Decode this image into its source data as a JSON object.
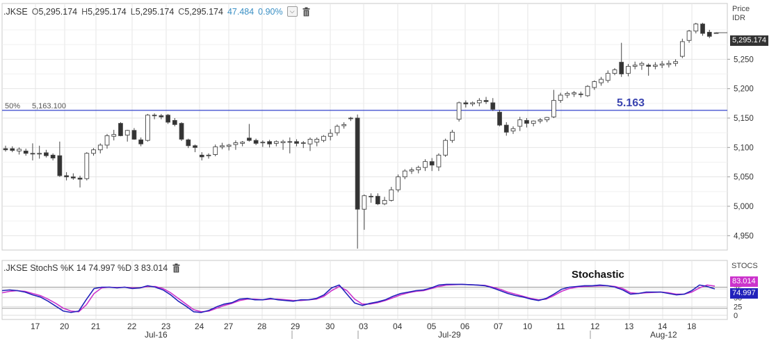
{
  "price_header": {
    "symbol": ".JKSE",
    "open_label": "O",
    "open": "5,295.174",
    "high_label": "H",
    "high": "5,295.174",
    "low_label": "L",
    "low": "5,295.174",
    "close_label": "C",
    "close": "5,295.174",
    "change": "47.484",
    "change_pct": "0.90%"
  },
  "price_axis": {
    "title": "Price",
    "unit": "IDR",
    "last_value": "5,295.174"
  },
  "stoch_header": {
    "text": ".JKSE StochS %K 14 74.997 %D 3 83.014"
  },
  "stoch_axis": {
    "title": "STOCS",
    "d_value": "83.014",
    "k_value": "74.997"
  },
  "colors": {
    "k_line": "#2222bb",
    "d_line": "#cc33cc",
    "hline": "#3344cc",
    "d_tag": "#cc33cc",
    "k_tag": "#2222bb",
    "last_tag": "#333333"
  },
  "chart_data": [
    {
      "type": "candlestick",
      "title": "",
      "ylabel": "Price IDR",
      "ylim": [
        4925,
        5315
      ],
      "y_ticks": [
        "4,950",
        "5,000",
        "5,050",
        "5,100",
        "5,150",
        "5,200",
        "5,250"
      ],
      "x_tick_labels": [
        "17",
        "20",
        "21",
        "22",
        "23",
        "24",
        "27",
        "28",
        "29",
        "30",
        "03",
        "04",
        "05",
        "06",
        "07",
        "10",
        "11",
        "12",
        "13",
        "14",
        "18"
      ],
      "x_month_labels": [
        "Jul-16",
        "Jul-29",
        "Aug-12"
      ],
      "fib_line": {
        "label": "50%",
        "value_label": "5,163.100",
        "value": 5163.1,
        "annotation": "5.163"
      },
      "candles": [
        {
          "d": "12",
          "o": 5098,
          "h": 5103,
          "l": 5093,
          "c": 5096
        },
        {
          "d": "13",
          "o": 5098,
          "h": 5102,
          "l": 5092,
          "c": 5095
        },
        {
          "d": "13",
          "o": 5094,
          "h": 5100,
          "l": 5088,
          "c": 5097
        },
        {
          "d": "14",
          "o": 5094,
          "h": 5098,
          "l": 5086,
          "c": 5090
        },
        {
          "d": "15",
          "o": 5090,
          "h": 5107,
          "l": 5078,
          "c": 5089
        },
        {
          "d": "16",
          "o": 5089,
          "h": 5103,
          "l": 5081,
          "c": 5090
        },
        {
          "d": "16",
          "o": 5091,
          "h": 5096,
          "l": 5083,
          "c": 5086
        },
        {
          "d": "17",
          "o": 5087,
          "h": 5090,
          "l": 5078,
          "c": 5082
        },
        {
          "d": "17",
          "o": 5086,
          "h": 5110,
          "l": 5050,
          "c": 5052
        },
        {
          "d": "18",
          "o": 5052,
          "h": 5058,
          "l": 5044,
          "c": 5050
        },
        {
          "d": "19",
          "o": 5050,
          "h": 5056,
          "l": 5045,
          "c": 5048
        },
        {
          "d": "20",
          "o": 5048,
          "h": 5052,
          "l": 5032,
          "c": 5046
        },
        {
          "d": "21",
          "o": 5047,
          "h": 5092,
          "l": 5044,
          "c": 5090
        },
        {
          "d": "21",
          "o": 5090,
          "h": 5099,
          "l": 5086,
          "c": 5096
        },
        {
          "d": "21",
          "o": 5096,
          "h": 5107,
          "l": 5090,
          "c": 5104
        },
        {
          "d": "22",
          "o": 5104,
          "h": 5123,
          "l": 5098,
          "c": 5120
        },
        {
          "d": "22",
          "o": 5119,
          "h": 5130,
          "l": 5112,
          "c": 5122
        },
        {
          "d": "22",
          "o": 5141,
          "h": 5143,
          "l": 5119,
          "c": 5120
        },
        {
          "d": "23",
          "o": 5121,
          "h": 5130,
          "l": 5110,
          "c": 5129
        },
        {
          "d": "23",
          "o": 5129,
          "h": 5133,
          "l": 5113,
          "c": 5114
        },
        {
          "d": "23",
          "o": 5113,
          "h": 5117,
          "l": 5102,
          "c": 5106
        },
        {
          "d": "24",
          "o": 5112,
          "h": 5157,
          "l": 5110,
          "c": 5155
        },
        {
          "d": "24",
          "o": 5155,
          "h": 5158,
          "l": 5148,
          "c": 5154
        },
        {
          "d": "24",
          "o": 5154,
          "h": 5157,
          "l": 5148,
          "c": 5152
        },
        {
          "d": "25",
          "o": 5155,
          "h": 5157,
          "l": 5140,
          "c": 5143
        },
        {
          "d": "25",
          "o": 5146,
          "h": 5150,
          "l": 5136,
          "c": 5139
        },
        {
          "d": "26",
          "o": 5141,
          "h": 5143,
          "l": 5111,
          "c": 5114
        },
        {
          "d": "26",
          "o": 5113,
          "h": 5115,
          "l": 5099,
          "c": 5103
        },
        {
          "d": "26",
          "o": 5103,
          "h": 5105,
          "l": 5092,
          "c": 5100
        },
        {
          "d": "27",
          "o": 5087,
          "h": 5092,
          "l": 5078,
          "c": 5084
        },
        {
          "d": "27",
          "o": 5086,
          "h": 5090,
          "l": 5081,
          "c": 5087
        },
        {
          "d": "28",
          "o": 5088,
          "h": 5105,
          "l": 5085,
          "c": 5101
        },
        {
          "d": "28",
          "o": 5101,
          "h": 5108,
          "l": 5097,
          "c": 5103
        },
        {
          "d": "28",
          "o": 5102,
          "h": 5106,
          "l": 5095,
          "c": 5104
        },
        {
          "d": "29",
          "o": 5105,
          "h": 5112,
          "l": 5096,
          "c": 5108
        },
        {
          "d": "29",
          "o": 5107,
          "h": 5111,
          "l": 5102,
          "c": 5109
        },
        {
          "d": "29",
          "o": 5116,
          "h": 5140,
          "l": 5110,
          "c": 5112
        },
        {
          "d": "30",
          "o": 5112,
          "h": 5115,
          "l": 5104,
          "c": 5107
        },
        {
          "d": "30",
          "o": 5108,
          "h": 5112,
          "l": 5101,
          "c": 5109
        },
        {
          "d": "30",
          "o": 5110,
          "h": 5113,
          "l": 5100,
          "c": 5106
        },
        {
          "d": "31",
          "o": 5107,
          "h": 5112,
          "l": 5102,
          "c": 5110
        },
        {
          "d": "31",
          "o": 5108,
          "h": 5113,
          "l": 5096,
          "c": 5110
        },
        {
          "d": "31",
          "o": 5110,
          "h": 5117,
          "l": 5090,
          "c": 5109
        },
        {
          "d": "32",
          "o": 5110,
          "h": 5114,
          "l": 5102,
          "c": 5107
        },
        {
          "d": "32",
          "o": 5107,
          "h": 5111,
          "l": 5099,
          "c": 5108
        },
        {
          "d": "33",
          "o": 5106,
          "h": 5117,
          "l": 5094,
          "c": 5114
        },
        {
          "d": "33",
          "o": 5109,
          "h": 5117,
          "l": 5102,
          "c": 5114
        },
        {
          "d": "33",
          "o": 5112,
          "h": 5121,
          "l": 5109,
          "c": 5119
        },
        {
          "d": "34",
          "o": 5119,
          "h": 5131,
          "l": 5112,
          "c": 5124
        },
        {
          "d": "34",
          "o": 5125,
          "h": 5139,
          "l": 5120,
          "c": 5136
        },
        {
          "d": "35",
          "o": 5137,
          "h": 5143,
          "l": 5132,
          "c": 5139
        },
        {
          "d": "35",
          "o": 5150,
          "h": 5152,
          "l": 5145,
          "c": 5149
        },
        {
          "d": "35",
          "o": 5150,
          "h": 5156,
          "l": 4928,
          "c": 4995
        },
        {
          "d": "36",
          "o": 4995,
          "h": 5020,
          "l": 4960,
          "c": 5018
        },
        {
          "d": "36",
          "o": 5017,
          "h": 5022,
          "l": 5006,
          "c": 5016
        },
        {
          "d": "36",
          "o": 5017,
          "h": 5022,
          "l": 5002,
          "c": 5004
        },
        {
          "d": "37",
          "o": 5004,
          "h": 5016,
          "l": 5002,
          "c": 5010
        },
        {
          "d": "37",
          "o": 5010,
          "h": 5033,
          "l": 5008,
          "c": 5028
        },
        {
          "d": "37",
          "o": 5028,
          "h": 5054,
          "l": 5024,
          "c": 5050
        },
        {
          "d": "38",
          "o": 5050,
          "h": 5063,
          "l": 5046,
          "c": 5060
        },
        {
          "d": "38",
          "o": 5060,
          "h": 5066,
          "l": 5055,
          "c": 5062
        },
        {
          "d": "38",
          "o": 5062,
          "h": 5069,
          "l": 5056,
          "c": 5066
        },
        {
          "d": "39",
          "o": 5066,
          "h": 5080,
          "l": 5060,
          "c": 5076
        },
        {
          "d": "39",
          "o": 5076,
          "h": 5082,
          "l": 5060,
          "c": 5070
        },
        {
          "d": "39",
          "o": 5067,
          "h": 5090,
          "l": 5060,
          "c": 5087
        },
        {
          "d": "40",
          "o": 5087,
          "h": 5115,
          "l": 5084,
          "c": 5112
        },
        {
          "d": "40",
          "o": 5112,
          "h": 5130,
          "l": 5108,
          "c": 5126
        },
        {
          "d": "40",
          "o": 5148,
          "h": 5178,
          "l": 5144,
          "c": 5176
        },
        {
          "d": "41",
          "o": 5176,
          "h": 5180,
          "l": 5168,
          "c": 5174
        },
        {
          "d": "41",
          "o": 5174,
          "h": 5178,
          "l": 5170,
          "c": 5176
        },
        {
          "d": "42",
          "o": 5176,
          "h": 5184,
          "l": 5170,
          "c": 5180
        },
        {
          "d": "42",
          "o": 5180,
          "h": 5186,
          "l": 5174,
          "c": 5178
        },
        {
          "d": "42",
          "o": 5176,
          "h": 5184,
          "l": 5162,
          "c": 5165
        },
        {
          "d": "43",
          "o": 5160,
          "h": 5164,
          "l": 5136,
          "c": 5138
        },
        {
          "d": "43",
          "o": 5138,
          "h": 5143,
          "l": 5120,
          "c": 5126
        },
        {
          "d": "43",
          "o": 5128,
          "h": 5136,
          "l": 5123,
          "c": 5132
        },
        {
          "d": "44",
          "o": 5136,
          "h": 5152,
          "l": 5128,
          "c": 5147
        },
        {
          "d": "44",
          "o": 5146,
          "h": 5150,
          "l": 5134,
          "c": 5141
        },
        {
          "d": "44",
          "o": 5141,
          "h": 5146,
          "l": 5136,
          "c": 5145
        },
        {
          "d": "45",
          "o": 5145,
          "h": 5150,
          "l": 5141,
          "c": 5147
        },
        {
          "d": "45",
          "o": 5147,
          "h": 5152,
          "l": 5143,
          "c": 5151
        },
        {
          "d": "45",
          "o": 5152,
          "h": 5198,
          "l": 5150,
          "c": 5180
        },
        {
          "d": "46",
          "o": 5180,
          "h": 5193,
          "l": 5176,
          "c": 5189
        },
        {
          "d": "46",
          "o": 5189,
          "h": 5195,
          "l": 5184,
          "c": 5192
        },
        {
          "d": "46",
          "o": 5191,
          "h": 5196,
          "l": 5186,
          "c": 5193
        },
        {
          "d": "47",
          "o": 5191,
          "h": 5195,
          "l": 5185,
          "c": 5190
        },
        {
          "d": "47",
          "o": 5188,
          "h": 5206,
          "l": 5186,
          "c": 5204
        },
        {
          "d": "47",
          "o": 5202,
          "h": 5214,
          "l": 5198,
          "c": 5212
        },
        {
          "d": "48",
          "o": 5210,
          "h": 5220,
          "l": 5205,
          "c": 5216
        },
        {
          "d": "48",
          "o": 5214,
          "h": 5231,
          "l": 5210,
          "c": 5226
        },
        {
          "d": "48",
          "o": 5226,
          "h": 5235,
          "l": 5223,
          "c": 5232
        },
        {
          "d": "49",
          "o": 5245,
          "h": 5278,
          "l": 5220,
          "c": 5225
        },
        {
          "d": "49",
          "o": 5226,
          "h": 5242,
          "l": 5221,
          "c": 5238
        },
        {
          "d": "49",
          "o": 5238,
          "h": 5246,
          "l": 5233,
          "c": 5240
        },
        {
          "d": "50",
          "o": 5240,
          "h": 5246,
          "l": 5232,
          "c": 5243
        },
        {
          "d": "50",
          "o": 5240,
          "h": 5243,
          "l": 5222,
          "c": 5238
        },
        {
          "d": "50",
          "o": 5238,
          "h": 5245,
          "l": 5233,
          "c": 5240
        },
        {
          "d": "51",
          "o": 5240,
          "h": 5247,
          "l": 5235,
          "c": 5242
        },
        {
          "d": "51",
          "o": 5241,
          "h": 5248,
          "l": 5236,
          "c": 5243
        },
        {
          "d": "51",
          "o": 5243,
          "h": 5250,
          "l": 5238,
          "c": 5246
        },
        {
          "d": "52",
          "o": 5255,
          "h": 5285,
          "l": 5252,
          "c": 5280
        },
        {
          "d": "52",
          "o": 5282,
          "h": 5300,
          "l": 5278,
          "c": 5298
        },
        {
          "d": "52",
          "o": 5298,
          "h": 5312,
          "l": 5294,
          "c": 5310
        },
        {
          "d": "53",
          "o": 5310,
          "h": 5312,
          "l": 5290,
          "c": 5294
        },
        {
          "d": "53",
          "o": 5296,
          "h": 5300,
          "l": 5286,
          "c": 5289
        },
        {
          "d": "53",
          "o": 5295,
          "h": 5296,
          "l": 5294,
          "c": 5295
        }
      ]
    },
    {
      "type": "line",
      "title": "Stochastic",
      "ylim": [
        0,
        100
      ],
      "y_ticks": [
        "0",
        "25",
        "50",
        "75"
      ],
      "series": [
        {
          "name": "%K",
          "values": [
            70,
            72,
            70,
            66,
            58,
            52,
            40,
            26,
            12,
            8,
            12,
            45,
            76,
            80,
            80,
            78,
            80,
            76,
            78,
            84,
            80,
            72,
            58,
            40,
            26,
            10,
            8,
            14,
            24,
            32,
            36,
            46,
            48,
            44,
            44,
            48,
            44,
            42,
            40,
            44,
            44,
            48,
            58,
            78,
            86,
            60,
            35,
            28,
            34,
            38,
            44,
            54,
            62,
            66,
            70,
            72,
            78,
            86,
            88,
            88,
            88,
            87,
            86,
            84,
            78,
            70,
            62,
            56,
            52,
            46,
            42,
            48,
            60,
            74,
            80,
            82,
            84,
            84,
            86,
            84,
            80,
            72,
            60,
            62,
            66,
            66,
            66,
            62,
            58,
            60,
            70,
            86,
            82,
            75
          ]
        },
        {
          "name": "%D",
          "values": [
            64,
            68,
            70,
            68,
            62,
            56,
            46,
            34,
            20,
            12,
            10,
            30,
            62,
            78,
            80,
            79,
            80,
            78,
            78,
            82,
            82,
            76,
            64,
            48,
            32,
            16,
            10,
            12,
            20,
            28,
            34,
            42,
            46,
            46,
            44,
            46,
            46,
            44,
            42,
            42,
            44,
            46,
            54,
            70,
            82,
            70,
            46,
            32,
            32,
            36,
            42,
            50,
            58,
            64,
            68,
            70,
            76,
            82,
            86,
            87,
            88,
            87,
            86,
            85,
            80,
            74,
            66,
            60,
            54,
            48,
            44,
            46,
            56,
            68,
            76,
            80,
            82,
            83,
            84,
            84,
            82,
            76,
            64,
            62,
            64,
            65,
            66,
            64,
            60,
            60,
            66,
            78,
            86,
            83
          ]
        }
      ]
    }
  ]
}
